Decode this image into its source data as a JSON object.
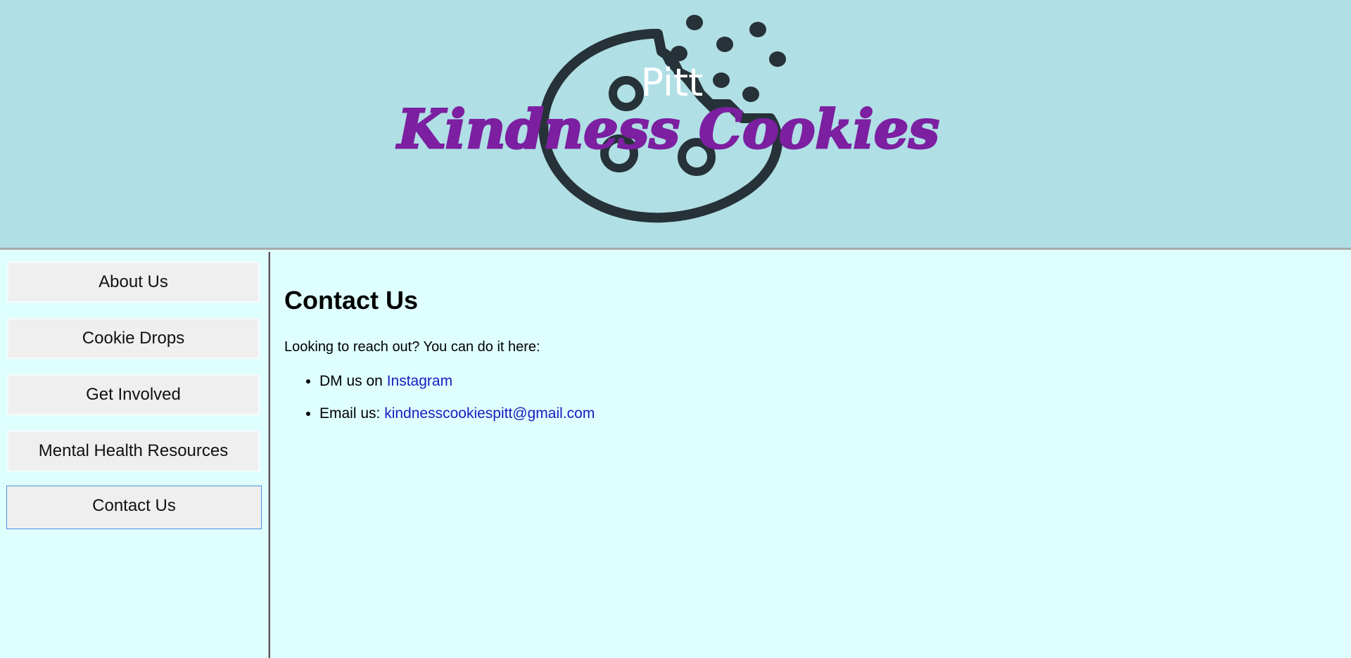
{
  "header": {
    "logo_top_text": "Pitt",
    "logo_main_text": "Kindness Cookies",
    "logo_text_color": "#7c1fa0",
    "cookie_color": "#263238"
  },
  "sidebar": {
    "items": [
      {
        "label": "About Us"
      },
      {
        "label": "Cookie Drops"
      },
      {
        "label": "Get Involved"
      },
      {
        "label": "Mental Health Resources"
      },
      {
        "label": "Contact Us",
        "active": true
      }
    ]
  },
  "main": {
    "title": "Contact Us",
    "intro": "Looking to reach out? You can do it here:",
    "items": [
      {
        "prefix": "DM us on ",
        "link_text": "Instagram"
      },
      {
        "prefix": "Email us: ",
        "link_text": "kindnesscookiespitt@gmail.com"
      }
    ]
  },
  "colors": {
    "header_bg": "#b0dfe5",
    "page_bg": "#dfffff",
    "link": "#1a1abf"
  }
}
